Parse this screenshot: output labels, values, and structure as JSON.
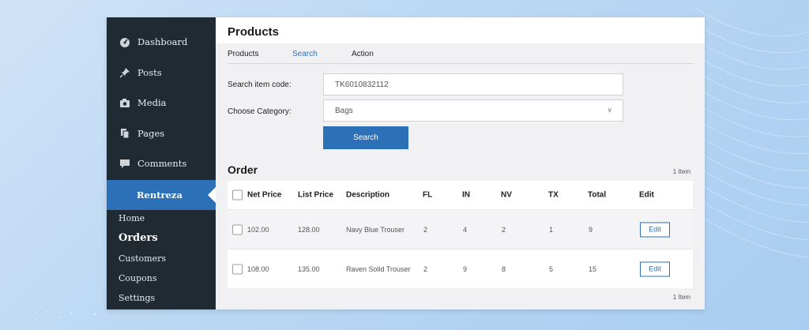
{
  "sidebar": {
    "items": [
      {
        "label": "Dashboard",
        "icon": "dashboard-icon"
      },
      {
        "label": "Posts",
        "icon": "pin-icon"
      },
      {
        "label": "Media",
        "icon": "camera-icon"
      },
      {
        "label": "Pages",
        "icon": "pages-icon"
      },
      {
        "label": "Comments",
        "icon": "comment-icon"
      },
      {
        "label": "Rentreza",
        "active": true
      }
    ],
    "submenu": [
      "Home",
      "Orders",
      "Customers",
      "Coupons",
      "Settings"
    ],
    "current_submenu": "Orders"
  },
  "header": {
    "title": "Products"
  },
  "tabs": [
    "Products",
    "Search",
    "Action"
  ],
  "form": {
    "item_code_label": "Search item code:",
    "item_code_value": "TK6010832112",
    "category_label": "Choose Category:",
    "category_value": "Bags",
    "search_button": "Search"
  },
  "order": {
    "title": "Order",
    "count_label": "1 Item",
    "columns": [
      "Net Price",
      "List Price",
      "Description",
      "FL",
      "IN",
      "NV",
      "TX",
      "Total",
      "Edit"
    ],
    "rows": [
      {
        "net": "102.00",
        "list": "128.00",
        "desc": "Navy Blue Trouser",
        "fl": "2",
        "in": "4",
        "nv": "2",
        "tx": "1",
        "total": "9",
        "edit": "Edit"
      },
      {
        "net": "108.00",
        "list": "135.00",
        "desc": "Raven Solid Trouser",
        "fl": "2",
        "in": "9",
        "nv": "8",
        "tx": "5",
        "total": "15",
        "edit": "Edit"
      }
    ]
  },
  "colors": {
    "accent": "#2c71b8",
    "sidebar_bg": "#1f2a33"
  }
}
